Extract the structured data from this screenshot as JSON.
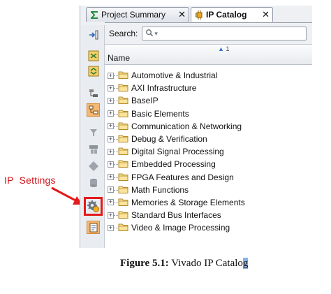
{
  "annotation": {
    "label": "IP  Settings"
  },
  "tabs": [
    {
      "label": "Project Summary",
      "icon": "sigma-icon",
      "active": false
    },
    {
      "label": "IP Catalog",
      "icon": "ip-chip-icon",
      "active": true
    }
  ],
  "search": {
    "label": "Search:",
    "placeholder": "Q-"
  },
  "table": {
    "column_header": "Name",
    "sort_indicator": "1"
  },
  "tree_items": [
    {
      "label": "Automotive & Industrial"
    },
    {
      "label": "AXI Infrastructure"
    },
    {
      "label": "BaseIP"
    },
    {
      "label": "Basic Elements"
    },
    {
      "label": "Communication & Networking"
    },
    {
      "label": "Debug & Verification"
    },
    {
      "label": "Digital Signal Processing"
    },
    {
      "label": "Embedded Processing"
    },
    {
      "label": "FPGA Features and Design"
    },
    {
      "label": "Math Functions"
    },
    {
      "label": "Memories & Storage Elements"
    },
    {
      "label": "Standard Bus Interfaces"
    },
    {
      "label": "Video & Image Processing"
    }
  ],
  "caption": {
    "prefix": "Figure 5.1:",
    "text": " Vivado IP Catalo",
    "last": "g"
  },
  "colors": {
    "annotation_red": "#d1141a",
    "selected_tool": "#f2b874",
    "folder": "#e6b84a"
  }
}
